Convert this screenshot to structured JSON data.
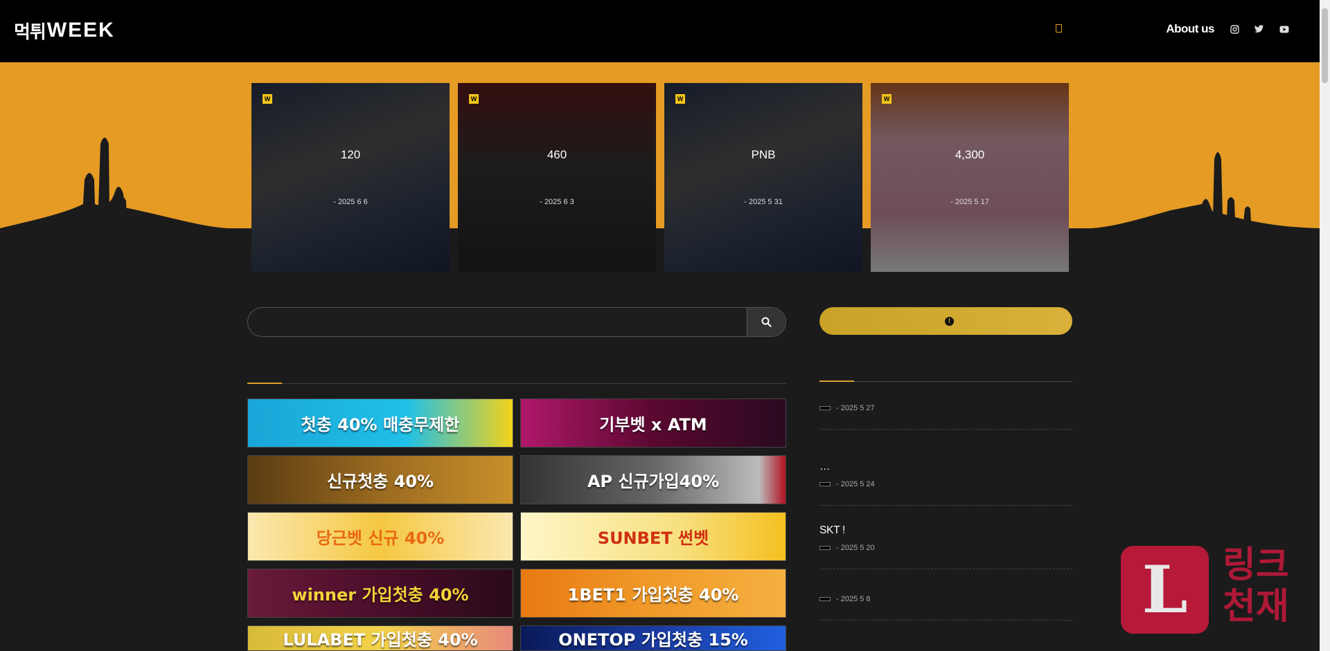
{
  "header": {
    "logo_kr": "먹튀",
    "logo_en": "WEEK",
    "nav": [
      {
        "label": "",
        "icon": "home-icon"
      },
      {
        "label": ""
      },
      {
        "label": ""
      },
      {
        "label": ""
      },
      {
        "label": ""
      },
      {
        "label": "About us"
      }
    ],
    "social": [
      "instagram-icon",
      "twitter-icon",
      "youtube-icon"
    ]
  },
  "hero": {
    "badge": "W",
    "cards": [
      {
        "title": "  120    ",
        "meta": " - 2025 6 6"
      },
      {
        "title": "         460 ",
        "meta": " - 2025 6 3"
      },
      {
        "title": "PNB        ",
        "meta": " - 2025 5 31"
      },
      {
        "title": "    4,300     ",
        "meta": " - 2025 5 17"
      }
    ]
  },
  "search": {
    "placeholder": ""
  },
  "featured": {
    "title": "  "
  },
  "banners": [
    {
      "text": "첫충 40% 매충무제한"
    },
    {
      "text": "기부벳 x ATM"
    },
    {
      "text": "신규첫충 40%"
    },
    {
      "text": "AP 신규가입40%"
    },
    {
      "text": "당근벳 신규 40%"
    },
    {
      "text": "SUNBET 썬벳"
    },
    {
      "text": "winner 가입첫충 40%"
    },
    {
      "text": "1BET1 가입첫충 40%"
    },
    {
      "text": "LULABET 가입첫충 40%"
    },
    {
      "text": "ONETOP 가입첫충 15%"
    }
  ],
  "sidebar": {
    "notice_label": "     ",
    "notice_icon": "!",
    "recent_title": " ",
    "news": [
      {
        "title": "          ",
        "tag": "",
        "meta": " - 2025 5 27"
      },
      {
        "title": "        …",
        "tag": "",
        "meta": " - 2025 5 24"
      },
      {
        "title": "SKT      !",
        "tag": "",
        "meta": " - 2025 5 20"
      },
      {
        "title": "     ",
        "tag": "",
        "meta": " - 2025 5 8"
      }
    ]
  },
  "watermark": {
    "letter": "L",
    "line1": "링크",
    "line2": "천재"
  },
  "colors": {
    "accent": "#e59b24",
    "header": "#000000",
    "body": "#1b1b1b",
    "notice": "#d0a930",
    "watermark": "#c8193c"
  }
}
